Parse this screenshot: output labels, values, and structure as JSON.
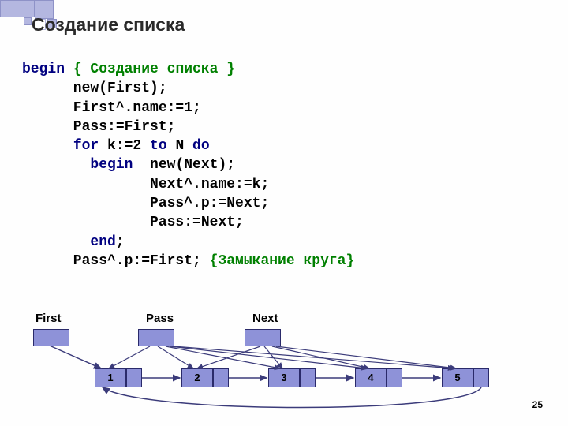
{
  "title": "Создание списка",
  "page_number": "25",
  "code": {
    "l1_kw": "begin",
    "l1_cm": " { Создание списка }",
    "l2": "      new(First);",
    "l3": "      First^.name:=1;",
    "l4": "      Pass:=First;",
    "l5a": "      ",
    "l5_for": "for",
    "l5b": " k:=2 ",
    "l5_to": "to",
    "l5c": " N ",
    "l5_do": "do",
    "l6a": "        ",
    "l6_begin": "begin",
    "l6b": "  new(Next);",
    "l7": "               Next^.name:=k;",
    "l8": "               Pass^.p:=Next;",
    "l9": "               Pass:=Next;",
    "l10a": "        ",
    "l10_end": "end",
    "l10b": ";",
    "l11a": "      Pass^.p:=First; ",
    "l11_cm": "{Замыкание круга}"
  },
  "diagram": {
    "labels": {
      "first": "First",
      "pass": "Pass",
      "next": "Next"
    },
    "nodes": [
      "1",
      "2",
      "3",
      "4",
      "5"
    ]
  }
}
